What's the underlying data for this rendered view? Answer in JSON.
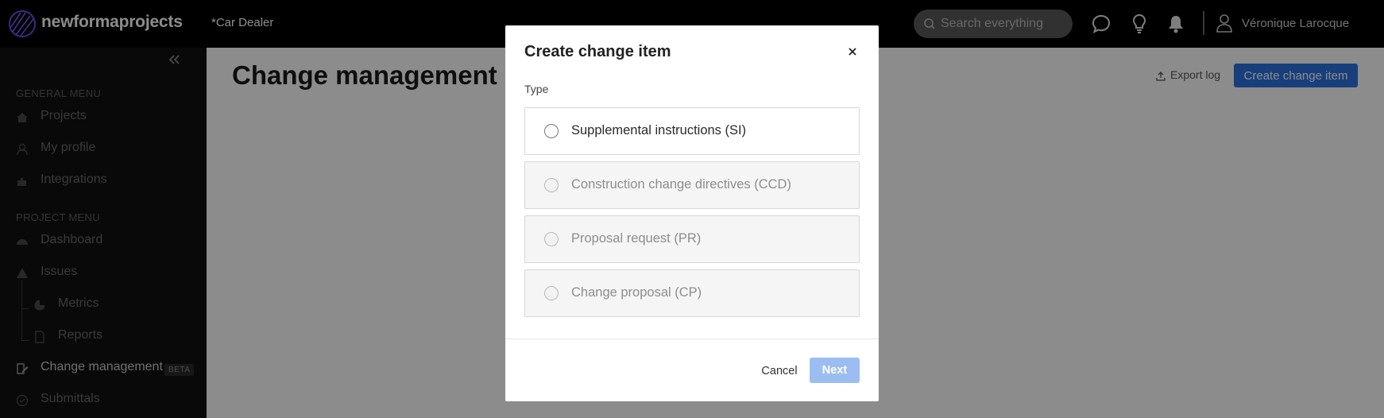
{
  "app": {
    "brand": "newformaprojects",
    "project_name": "*Car Dealer"
  },
  "topbar": {
    "search_placeholder": "Search everything",
    "user_name": "Véronique Larocque",
    "icons": [
      "chat-icon",
      "lightbulb-icon",
      "bell-icon",
      "user-icon"
    ]
  },
  "sidebar": {
    "general_heading": "GENERAL MENU",
    "general_items": [
      {
        "label": "Projects",
        "icon": "home-icon"
      },
      {
        "label": "My profile",
        "icon": "user-icon"
      },
      {
        "label": "Integrations",
        "icon": "puzzle-icon"
      }
    ],
    "project_heading": "PROJECT MENU",
    "project_items": [
      {
        "label": "Dashboard",
        "icon": "gauge-icon"
      },
      {
        "label": "Issues",
        "icon": "warning-icon"
      },
      {
        "label": "Metrics",
        "icon": "pie-chart-icon"
      },
      {
        "label": "Reports",
        "icon": "document-icon"
      },
      {
        "label": "Change management",
        "icon": "edit-document-icon",
        "badge": "BETA",
        "active": true
      },
      {
        "label": "Submittals",
        "icon": "check-circle-icon"
      }
    ]
  },
  "main": {
    "title": "Change management",
    "export_label": "Export log",
    "create_button": "Create change item"
  },
  "modal": {
    "title": "Create change item",
    "type_label": "Type",
    "options": [
      {
        "label": "Supplemental instructions (SI)",
        "enabled": true
      },
      {
        "label": "Construction change directives (CCD)",
        "enabled": false
      },
      {
        "label": "Proposal request (PR)",
        "enabled": false
      },
      {
        "label": "Change proposal (CP)",
        "enabled": false
      }
    ],
    "cancel_label": "Cancel",
    "next_label": "Next"
  },
  "colors": {
    "accent": "#2c73e0",
    "next_disabled": "#9cbdf2",
    "topbar_bg": "#000000",
    "sidebar_bg": "#111111"
  }
}
